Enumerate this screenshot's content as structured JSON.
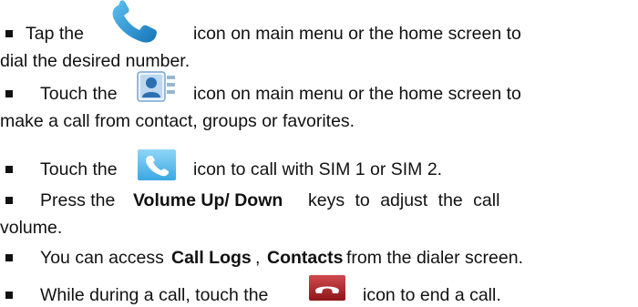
{
  "bullets": [
    {
      "line1": [
        "Tap the",
        "icon on main menu or the home screen to"
      ],
      "line2": "dial the desired number.",
      "icon": "phone-handset-icon"
    },
    {
      "line1": [
        "Touch the",
        "icon on main menu or the home screen to"
      ],
      "line2": "make a call from contact, groups or favorites.",
      "icon": "contacts-icon"
    },
    {
      "line1": [
        "Touch the",
        "icon to call with SIM 1 or SIM 2."
      ],
      "icon": "dial-button-icon"
    },
    {
      "line1": [
        "Press the",
        "Volume Up/ Down",
        "keys to adjust the call"
      ],
      "line2": "volume."
    },
    {
      "line1": [
        "You can access",
        "Call Logs",
        ",",
        "Contacts",
        "from the dialer screen."
      ]
    },
    {
      "line1": [
        "While during a call, touch the",
        "icon to end a call."
      ],
      "icon": "end-call-icon"
    }
  ],
  "colors": {
    "phone_blue": "#1f8fd6",
    "contacts_blue": "#3a7fc4",
    "dial_tile": "#4db8ee",
    "end_call_red": "#b3262b",
    "text": "#111111"
  }
}
